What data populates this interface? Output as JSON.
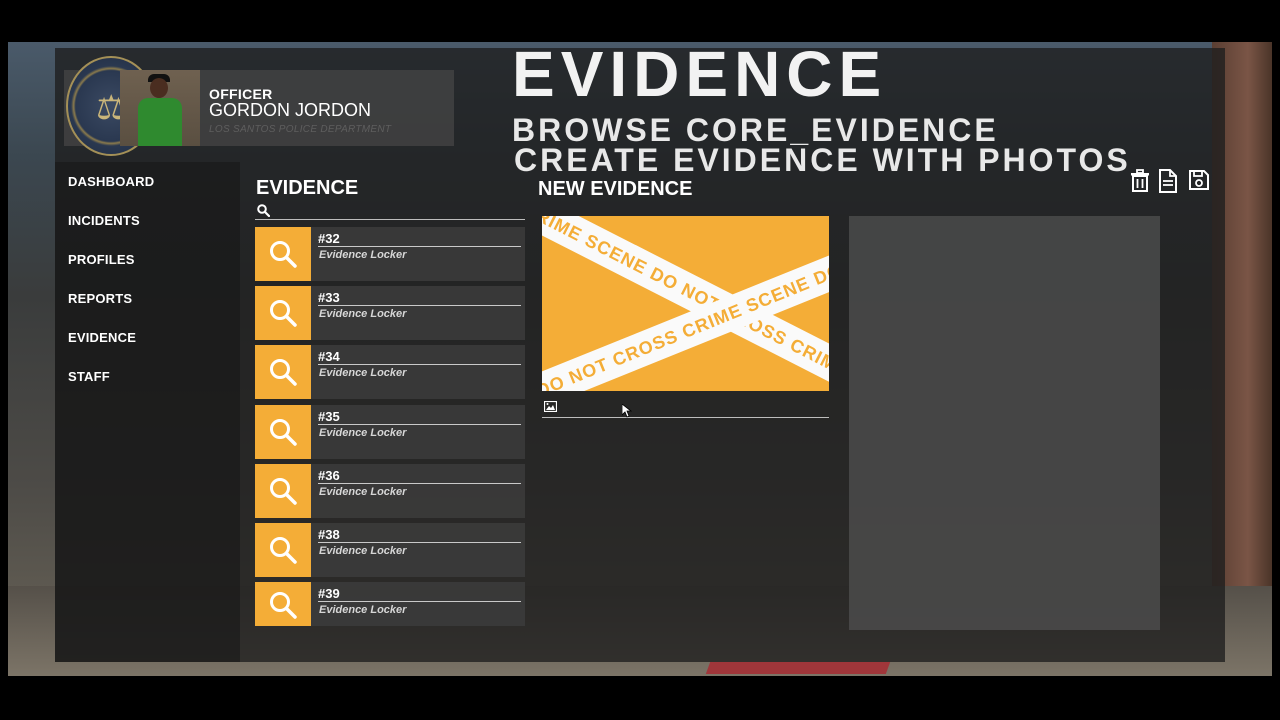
{
  "overlay": {
    "title": "EVIDENCE",
    "line1": "BROWSE CORE_EVIDENCE",
    "line2": "CREATE EVIDENCE WITH PHOTOS"
  },
  "officer": {
    "rank": "OFFICER",
    "name": "GORDON JORDON",
    "department": "LOS SANTOS POLICE DEPARTMENT"
  },
  "nav": {
    "items": [
      {
        "label": "DASHBOARD"
      },
      {
        "label": "INCIDENTS"
      },
      {
        "label": "PROFILES"
      },
      {
        "label": "REPORTS"
      },
      {
        "label": "EVIDENCE"
      },
      {
        "label": "STAFF"
      }
    ]
  },
  "evidence_list": {
    "heading": "EVIDENCE",
    "search_placeholder": "",
    "items": [
      {
        "number": "#32",
        "location": "Evidence Locker"
      },
      {
        "number": "#33",
        "location": "Evidence Locker"
      },
      {
        "number": "#34",
        "location": "Evidence Locker"
      },
      {
        "number": "#35",
        "location": "Evidence Locker"
      },
      {
        "number": "#36",
        "location": "Evidence Locker"
      },
      {
        "number": "#38",
        "location": "Evidence Locker"
      },
      {
        "number": "#39",
        "location": "Evidence Locker"
      }
    ]
  },
  "new_evidence": {
    "heading": "NEW EVIDENCE",
    "tape_text_a": "CRIME SCENE DO NOT CROSS CRIME SCENE DO NOT CROSS",
    "tape_text_b": "DO NOT CROSS CRIME SCENE DO NOT CROSS CRIME"
  },
  "toolbar": {
    "icons": [
      "trash-icon",
      "document-icon",
      "save-icon"
    ]
  },
  "colors": {
    "accent": "#f4ad37",
    "panel": "#1e1e1e",
    "item_bg": "#3c3c3c"
  }
}
